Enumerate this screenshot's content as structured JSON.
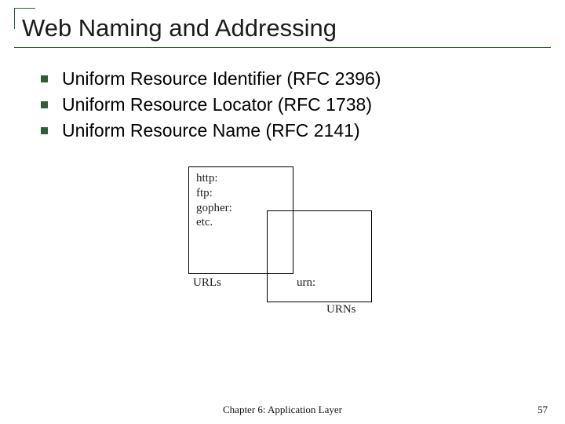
{
  "title": "Web Naming and Addressing",
  "bullets": [
    "Uniform Resource Identifier (RFC 2396)",
    "Uniform Resource Locator (RFC 1738)",
    "Uniform Resource Name (RFC 2141)"
  ],
  "diagram": {
    "schemes": [
      "http:",
      "ftp:",
      "gopher:",
      "etc."
    ],
    "label_urls": "URLs",
    "label_urn": "urn:",
    "label_urns": "URNs"
  },
  "footer": "Chapter 6: Application Layer",
  "page_number": "57"
}
